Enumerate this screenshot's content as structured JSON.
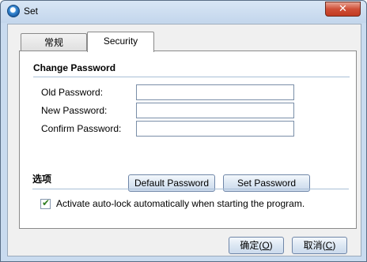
{
  "window": {
    "title": "Set",
    "close_label": "✕"
  },
  "tabs": [
    {
      "label": "常规",
      "active": false
    },
    {
      "label": "Security",
      "active": true
    }
  ],
  "change_password": {
    "header": "Change Password",
    "old_label": "Old Password:",
    "new_label": "New Password:",
    "confirm_label": "Confirm Password:",
    "old_value": "",
    "new_value": "",
    "confirm_value": "",
    "default_button": "Default Password",
    "set_button": "Set Password"
  },
  "options": {
    "header": "选项",
    "autolock_checked": true,
    "autolock_label": "Activate auto-lock automatically when starting the program."
  },
  "footer": {
    "ok_label": "确定",
    "ok_key": "O",
    "cancel_label": "取消",
    "cancel_key": "C"
  }
}
